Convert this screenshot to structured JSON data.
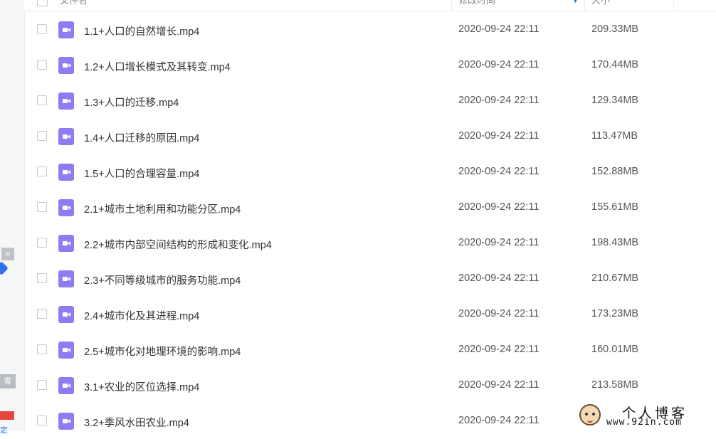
{
  "header": {
    "col_name": "文件名",
    "col_modified": "修改时间",
    "col_size": "大小"
  },
  "files": [
    {
      "name": "1.1+人口的自然增长.mp4",
      "modified": "2020-09-24 22:11",
      "size": "209.33MB"
    },
    {
      "name": "1.2+人口增长模式及其转变.mp4",
      "modified": "2020-09-24 22:11",
      "size": "170.44MB"
    },
    {
      "name": "1.3+人口的迁移.mp4",
      "modified": "2020-09-24 22:11",
      "size": "129.34MB"
    },
    {
      "name": "1.4+人口迁移的原因.mp4",
      "modified": "2020-09-24 22:11",
      "size": "113.47MB"
    },
    {
      "name": "1.5+人口的合理容量.mp4",
      "modified": "2020-09-24 22:11",
      "size": "152.88MB"
    },
    {
      "name": "2.1+城市土地利用和功能分区.mp4",
      "modified": "2020-09-24 22:11",
      "size": "155.61MB"
    },
    {
      "name": "2.2+城市内部空间结构的形成和变化.mp4",
      "modified": "2020-09-24 22:11",
      "size": "198.43MB"
    },
    {
      "name": "2.3+不同等级城市的服务功能.mp4",
      "modified": "2020-09-24 22:11",
      "size": "210.67MB"
    },
    {
      "name": "2.4+城市化及其进程.mp4",
      "modified": "2020-09-24 22:11",
      "size": "173.23MB"
    },
    {
      "name": "2.5+城市化对地理环境的影响.mp4",
      "modified": "2020-09-24 22:11",
      "size": "160.01MB"
    },
    {
      "name": "3.1+农业的区位选择.mp4",
      "modified": "2020-09-24 22:11",
      "size": "213.58MB"
    },
    {
      "name": "3.2+季风水田农业.mp4",
      "modified": "2020-09-24 22:11",
      "size": ""
    }
  ],
  "sidebar": {
    "close_glyph": "×",
    "label": "客",
    "bottom_text": "定"
  },
  "watermark": {
    "title": "个人博客",
    "url": "www.92in.com"
  },
  "colors": {
    "video_icon": "#8f7cf3",
    "accent": "#2f6ff0"
  },
  "icons": {
    "file": "video-file-icon",
    "sort": "sort-arrow-icon"
  }
}
